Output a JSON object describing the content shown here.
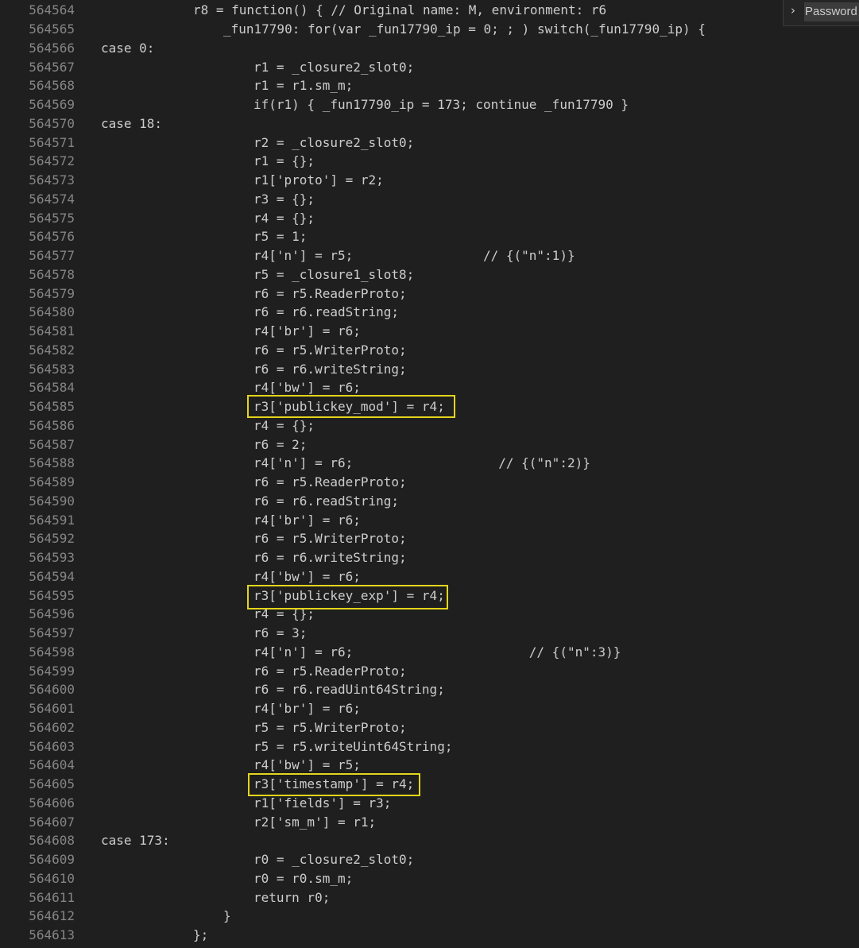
{
  "find_widget": {
    "toggle_icon": "chevron-right-icon",
    "input_value": "Password"
  },
  "editor": {
    "lines": [
      {
        "number": "564564",
        "text": "r8 = function() { // Original name: M, environment: r6"
      },
      {
        "number": "564565",
        "text": "_fun17790: for(var _fun17790_ip = 0; ; ) switch(_fun17790_ip) {"
      },
      {
        "number": "564566",
        "text": "case 0:"
      },
      {
        "number": "564567",
        "text": "r1 = _closure2_slot0;"
      },
      {
        "number": "564568",
        "text": "r1 = r1.sm_m;"
      },
      {
        "number": "564569",
        "text": "if(r1) { _fun17790_ip = 173; continue _fun17790 }"
      },
      {
        "number": "564570",
        "text": "case 18:"
      },
      {
        "number": "564571",
        "text": "r2 = _closure2_slot0;"
      },
      {
        "number": "564572",
        "text": "r1 = {};"
      },
      {
        "number": "564573",
        "text": "r1['proto'] = r2;"
      },
      {
        "number": "564574",
        "text": "r3 = {};"
      },
      {
        "number": "564575",
        "text": "r4 = {};"
      },
      {
        "number": "564576",
        "text": "r5 = 1;"
      },
      {
        "number": "564577",
        "text": "r4['n'] = r5;                 // {(\"n\":1)}"
      },
      {
        "number": "564578",
        "text": "r5 = _closure1_slot8;"
      },
      {
        "number": "564579",
        "text": "r6 = r5.ReaderProto;"
      },
      {
        "number": "564580",
        "text": "r6 = r6.readString;"
      },
      {
        "number": "564581",
        "text": "r4['br'] = r6;"
      },
      {
        "number": "564582",
        "text": "r6 = r5.WriterProto;"
      },
      {
        "number": "564583",
        "text": "r6 = r6.writeString;"
      },
      {
        "number": "564584",
        "text": "r4['bw'] = r6;"
      },
      {
        "number": "564585",
        "text": "r3['publickey_mod'] = r4;"
      },
      {
        "number": "564586",
        "text": "r4 = {};"
      },
      {
        "number": "564587",
        "text": "r6 = 2;"
      },
      {
        "number": "564588",
        "text": "r4['n'] = r6;                   // {(\"n\":2)}"
      },
      {
        "number": "564589",
        "text": "r6 = r5.ReaderProto;"
      },
      {
        "number": "564590",
        "text": "r6 = r6.readString;"
      },
      {
        "number": "564591",
        "text": "r4['br'] = r6;"
      },
      {
        "number": "564592",
        "text": "r6 = r5.WriterProto;"
      },
      {
        "number": "564593",
        "text": "r6 = r6.writeString;"
      },
      {
        "number": "564594",
        "text": "r4['bw'] = r6;"
      },
      {
        "number": "564595",
        "text": "r3['publickey_exp'] = r4;"
      },
      {
        "number": "564596",
        "text": "r4 = {};"
      },
      {
        "number": "564597",
        "text": "r6 = 3;"
      },
      {
        "number": "564598",
        "text": "r4['n'] = r6;                       // {(\"n\":3)}"
      },
      {
        "number": "564599",
        "text": "r6 = r5.ReaderProto;"
      },
      {
        "number": "564600",
        "text": "r6 = r6.readUint64String;"
      },
      {
        "number": "564601",
        "text": "r4['br'] = r6;"
      },
      {
        "number": "564602",
        "text": "r5 = r5.WriterProto;"
      },
      {
        "number": "564603",
        "text": "r5 = r5.writeUint64String;"
      },
      {
        "number": "564604",
        "text": "r4['bw'] = r5;"
      },
      {
        "number": "564605",
        "text": "r3['timestamp'] = r4;"
      },
      {
        "number": "564606",
        "text": "r1['fields'] = r3;"
      },
      {
        "number": "564607",
        "text": "r2['sm_m'] = r1;"
      },
      {
        "number": "564608",
        "text": "case 173:"
      },
      {
        "number": "564609",
        "text": "r0 = _closure2_slot0;"
      },
      {
        "number": "564610",
        "text": "r0 = r0.sm_m;"
      },
      {
        "number": "564611",
        "text": "return r0;"
      },
      {
        "number": "564612",
        "text": "}"
      },
      {
        "number": "564613",
        "text": "};"
      }
    ]
  },
  "colors": {
    "background": "#1f1f1f",
    "text": "#cccccc",
    "line_number": "#858585",
    "highlight_border": "#e2d51c"
  }
}
